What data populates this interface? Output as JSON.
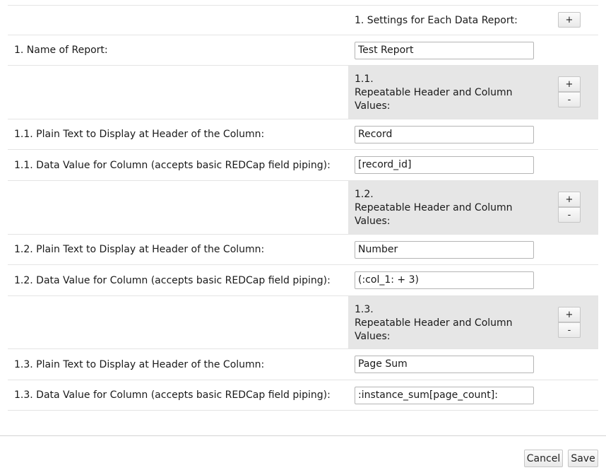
{
  "settings": {
    "section_title": "1. Settings for Each Data Report:",
    "add_report_label": "+",
    "report_name": {
      "label": "1. Name of Report:",
      "value": "Test Report"
    },
    "groups": [
      {
        "title_number": "1.1.",
        "title_text": "Repeatable Header and Column Values:",
        "add_label": "+",
        "remove_label": "-",
        "header_label": "1.1. Plain Text to Display at Header of the Column:",
        "header_value": "Record",
        "data_label": "1.1. Data Value for Column (accepts basic REDCap field piping):",
        "data_value": "[record_id]"
      },
      {
        "title_number": "1.2.",
        "title_text": "Repeatable Header and Column Values:",
        "add_label": "+",
        "remove_label": "-",
        "header_label": "1.2. Plain Text to Display at Header of the Column:",
        "header_value": "Number",
        "data_label": "1.2. Data Value for Column (accepts basic REDCap field piping):",
        "data_value": "(:col_1: + 3)"
      },
      {
        "title_number": "1.3.",
        "title_text": "Repeatable Header and Column Values:",
        "add_label": "+",
        "remove_label": "-",
        "header_label": "1.3. Plain Text to Display at Header of the Column:",
        "header_value": "Page Sum",
        "data_label": "1.3. Data Value for Column (accepts basic REDCap field piping):",
        "data_value": ":instance_sum[page_count]:"
      }
    ]
  },
  "footer": {
    "cancel_label": "Cancel",
    "save_label": "Save"
  },
  "colors": {
    "group_header_background": "#e6e6e6",
    "row_divider": "#e4e4e4",
    "input_border": "#b5b5b5",
    "text": "#1a1a1a"
  }
}
